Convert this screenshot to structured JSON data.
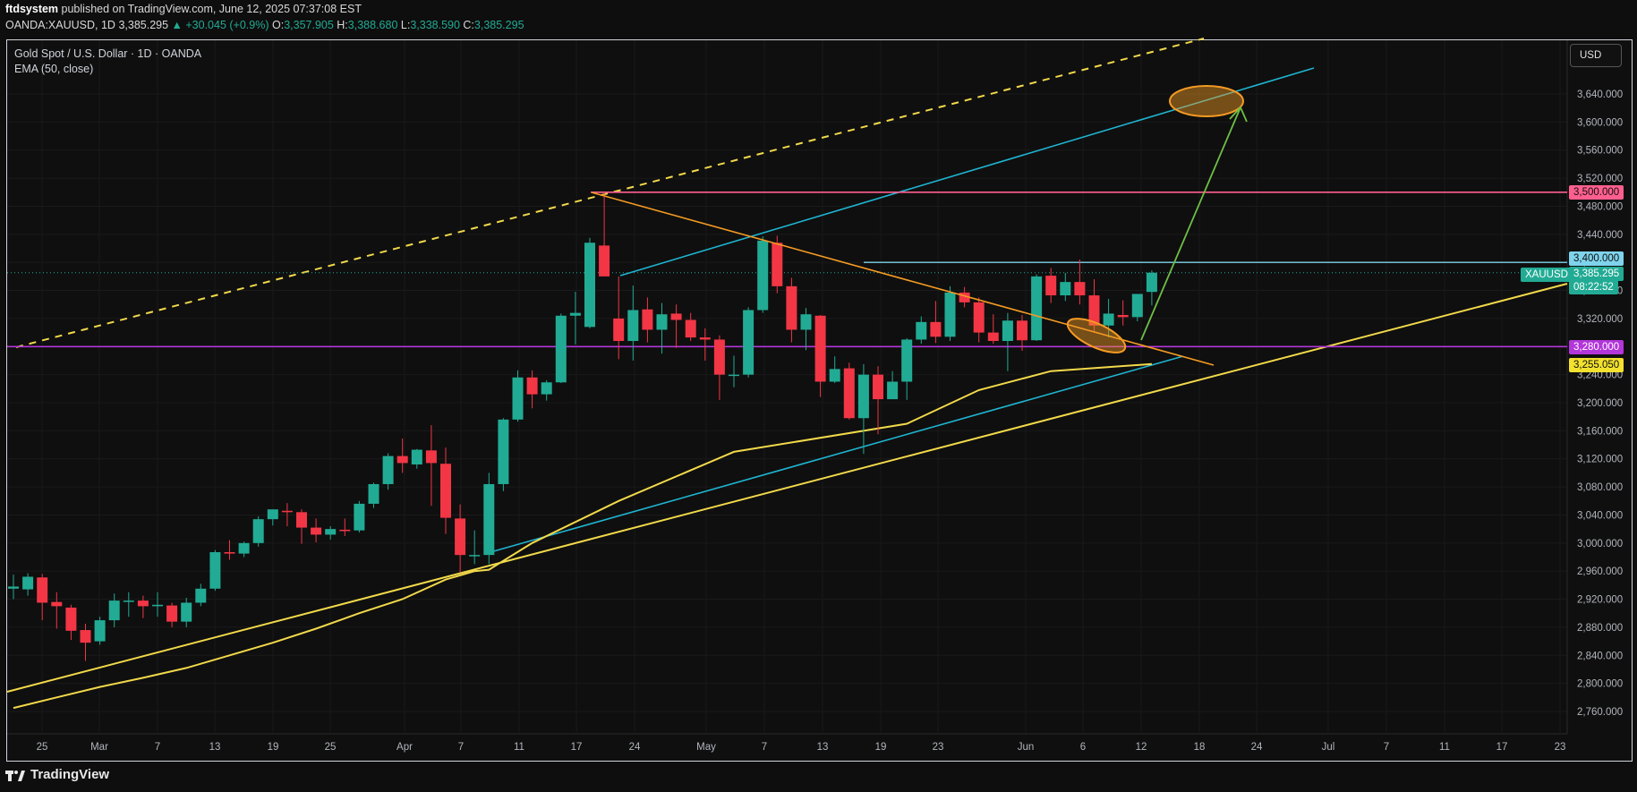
{
  "header": {
    "publisher": "ftdsystem",
    "published_text": "published on TradingView.com, June 12, 2025 07:37:08 EST",
    "symbol_line": "OANDA:XAUUSD, 1D",
    "last": "3,385.295",
    "change": "▲ +30.045 (+0.9%)",
    "open_label": "O:",
    "open": "3,357.905",
    "high_label": "H:",
    "high": "3,388.680",
    "low_label": "L:",
    "low": "3,338.590",
    "close_label": "C:",
    "close": "3,385.295"
  },
  "legend": {
    "title": "Gold Spot / U.S. Dollar · 1D · OANDA",
    "indicator": "EMA (50, close)"
  },
  "currency_button": "USD",
  "branding": "TradingView",
  "price_tags": {
    "r3500": "3,500.000",
    "r3400": "3,400.000",
    "symbol": "XAUUSD",
    "last": "3,385.295",
    "countdown": "08:22:52",
    "s3280": "3,280.000",
    "ema": "3,255.050"
  },
  "colors": {
    "up": "#22ab94",
    "down": "#f23645",
    "ema": "#f2d94a",
    "trend_yellow": "#f2d94a",
    "channel_cyan": "#1fb4d1",
    "triangle_orange": "#f59b23",
    "resistance_pink": "#ff5f8f",
    "support_purple": "#b236d9",
    "arrow_green": "#6fbf45"
  },
  "chart_data": {
    "type": "candlestick",
    "y_axis": {
      "min": 2740,
      "max": 3700,
      "ticks": [
        2760,
        2800,
        2840,
        2880,
        2920,
        2960,
        3000,
        3040,
        3080,
        3120,
        3160,
        3200,
        3240,
        3280,
        3320,
        3360,
        3400,
        3440,
        3480,
        3520,
        3560,
        3600,
        3640
      ],
      "tick_labels": [
        "2,760.000",
        "2,800.000",
        "2,840.000",
        "2,880.000",
        "2,920.000",
        "2,960.000",
        "3,000.000",
        "3,040.000",
        "3,080.000",
        "3,120.000",
        "3,160.000",
        "3,200.000",
        "3,240.000",
        "3,280.000",
        "3,320.000",
        "3,360.000",
        "3,400.000",
        "3,440.000",
        "3,480.000",
        "3,520.000",
        "3,560.000",
        "3,600.000",
        "3,640.000"
      ]
    },
    "x_axis": {
      "labels": [
        "25",
        "Mar",
        "7",
        "13",
        "19",
        "25",
        "Apr",
        "7",
        "11",
        "17",
        "24",
        "May",
        "7",
        "13",
        "19",
        "23",
        "Jun",
        "6",
        "12",
        "18",
        "24",
        "Jul",
        "7",
        "11",
        "17",
        "23"
      ]
    },
    "candles": [
      {
        "date": "2025-02-21",
        "o": 2935,
        "h": 2955,
        "l": 2920,
        "c": 2938
      },
      {
        "date": "2025-02-24",
        "o": 2934,
        "h": 2957,
        "l": 2925,
        "c": 2952
      },
      {
        "date": "2025-02-25",
        "o": 2951,
        "h": 2956,
        "l": 2890,
        "c": 2915
      },
      {
        "date": "2025-02-26",
        "o": 2916,
        "h": 2930,
        "l": 2878,
        "c": 2910
      },
      {
        "date": "2025-02-27",
        "o": 2908,
        "h": 2912,
        "l": 2862,
        "c": 2875
      },
      {
        "date": "2025-02-28",
        "o": 2876,
        "h": 2885,
        "l": 2832,
        "c": 2858
      },
      {
        "date": "2025-03-03",
        "o": 2860,
        "h": 2895,
        "l": 2855,
        "c": 2890
      },
      {
        "date": "2025-03-04",
        "o": 2890,
        "h": 2928,
        "l": 2880,
        "c": 2918
      },
      {
        "date": "2025-03-05",
        "o": 2918,
        "h": 2930,
        "l": 2895,
        "c": 2918
      },
      {
        "date": "2025-03-06",
        "o": 2918,
        "h": 2925,
        "l": 2893,
        "c": 2910
      },
      {
        "date": "2025-03-07",
        "o": 2910,
        "h": 2930,
        "l": 2895,
        "c": 2912
      },
      {
        "date": "2025-03-10",
        "o": 2911,
        "h": 2915,
        "l": 2880,
        "c": 2888
      },
      {
        "date": "2025-03-11",
        "o": 2888,
        "h": 2922,
        "l": 2880,
        "c": 2915
      },
      {
        "date": "2025-03-12",
        "o": 2915,
        "h": 2942,
        "l": 2910,
        "c": 2935
      },
      {
        "date": "2025-03-13",
        "o": 2935,
        "h": 2990,
        "l": 2932,
        "c": 2987
      },
      {
        "date": "2025-03-14",
        "o": 2987,
        "h": 3004,
        "l": 2976,
        "c": 2985
      },
      {
        "date": "2025-03-17",
        "o": 2985,
        "h": 3002,
        "l": 2980,
        "c": 3000
      },
      {
        "date": "2025-03-18",
        "o": 3000,
        "h": 3038,
        "l": 2995,
        "c": 3034
      },
      {
        "date": "2025-03-19",
        "o": 3034,
        "h": 3045,
        "l": 3025,
        "c": 3048
      },
      {
        "date": "2025-03-20",
        "o": 3046,
        "h": 3057,
        "l": 3024,
        "c": 3044
      },
      {
        "date": "2025-03-21",
        "o": 3044,
        "h": 3048,
        "l": 2999,
        "c": 3022
      },
      {
        "date": "2025-03-24",
        "o": 3022,
        "h": 3035,
        "l": 3001,
        "c": 3012
      },
      {
        "date": "2025-03-25",
        "o": 3012,
        "h": 3024,
        "l": 3005,
        "c": 3020
      },
      {
        "date": "2025-03-26",
        "o": 3019,
        "h": 3035,
        "l": 3010,
        "c": 3017
      },
      {
        "date": "2025-03-27",
        "o": 3018,
        "h": 3060,
        "l": 3015,
        "c": 3056
      },
      {
        "date": "2025-03-28",
        "o": 3056,
        "h": 3086,
        "l": 3050,
        "c": 3084
      },
      {
        "date": "2025-03-31",
        "o": 3084,
        "h": 3128,
        "l": 3076,
        "c": 3124
      },
      {
        "date": "2025-04-01",
        "o": 3124,
        "h": 3149,
        "l": 3100,
        "c": 3114
      },
      {
        "date": "2025-04-02",
        "o": 3112,
        "h": 3134,
        "l": 3106,
        "c": 3133
      },
      {
        "date": "2025-04-03",
        "o": 3132,
        "h": 3168,
        "l": 3053,
        "c": 3114
      },
      {
        "date": "2025-04-04",
        "o": 3113,
        "h": 3136,
        "l": 3013,
        "c": 3036
      },
      {
        "date": "2025-04-07",
        "o": 3035,
        "h": 3055,
        "l": 2958,
        "c": 2983
      },
      {
        "date": "2025-04-08",
        "o": 2983,
        "h": 3018,
        "l": 2970,
        "c": 2983
      },
      {
        "date": "2025-04-09",
        "o": 2983,
        "h": 3100,
        "l": 2970,
        "c": 3084
      },
      {
        "date": "2025-04-10",
        "o": 3084,
        "h": 3178,
        "l": 3074,
        "c": 3176
      },
      {
        "date": "2025-04-11",
        "o": 3176,
        "h": 3246,
        "l": 3173,
        "c": 3236
      },
      {
        "date": "2025-04-14",
        "o": 3236,
        "h": 3246,
        "l": 3192,
        "c": 3212
      },
      {
        "date": "2025-04-15",
        "o": 3212,
        "h": 3232,
        "l": 3203,
        "c": 3229
      },
      {
        "date": "2025-04-16",
        "o": 3229,
        "h": 3327,
        "l": 3228,
        "c": 3324
      },
      {
        "date": "2025-04-17",
        "o": 3324,
        "h": 3358,
        "l": 3283,
        "c": 3328
      },
      {
        "date": "2025-04-18",
        "o": 3308,
        "h": 3435,
        "l": 3306,
        "c": 3428
      },
      {
        "date": "2025-04-21",
        "o": 3424,
        "h": 3500,
        "l": 3380,
        "c": 3380
      },
      {
        "date": "2025-04-22",
        "o": 3320,
        "h": 3380,
        "l": 3262,
        "c": 3288
      },
      {
        "date": "2025-04-23",
        "o": 3288,
        "h": 3367,
        "l": 3260,
        "c": 3332
      },
      {
        "date": "2025-04-24",
        "o": 3333,
        "h": 3350,
        "l": 3286,
        "c": 3304
      },
      {
        "date": "2025-04-25",
        "o": 3304,
        "h": 3342,
        "l": 3270,
        "c": 3326
      },
      {
        "date": "2025-04-28",
        "o": 3327,
        "h": 3340,
        "l": 3278,
        "c": 3318
      },
      {
        "date": "2025-04-29",
        "o": 3318,
        "h": 3328,
        "l": 3288,
        "c": 3293
      },
      {
        "date": "2025-04-30",
        "o": 3293,
        "h": 3306,
        "l": 3260,
        "c": 3290
      },
      {
        "date": "2025-05-01",
        "o": 3290,
        "h": 3296,
        "l": 3204,
        "c": 3240
      },
      {
        "date": "2025-05-02",
        "o": 3240,
        "h": 3267,
        "l": 3222,
        "c": 3240
      },
      {
        "date": "2025-05-05",
        "o": 3240,
        "h": 3336,
        "l": 3236,
        "c": 3332
      },
      {
        "date": "2025-05-06",
        "o": 3332,
        "h": 3437,
        "l": 3328,
        "c": 3431
      },
      {
        "date": "2025-05-07",
        "o": 3428,
        "h": 3438,
        "l": 3356,
        "c": 3366
      },
      {
        "date": "2025-05-08",
        "o": 3366,
        "h": 3378,
        "l": 3286,
        "c": 3304
      },
      {
        "date": "2025-05-09",
        "o": 3304,
        "h": 3335,
        "l": 3275,
        "c": 3326
      },
      {
        "date": "2025-05-12",
        "o": 3324,
        "h": 3325,
        "l": 3208,
        "c": 3230
      },
      {
        "date": "2025-05-13",
        "o": 3230,
        "h": 3266,
        "l": 3228,
        "c": 3248
      },
      {
        "date": "2025-05-14",
        "o": 3249,
        "h": 3257,
        "l": 3176,
        "c": 3178
      },
      {
        "date": "2025-05-15",
        "o": 3178,
        "h": 3255,
        "l": 3127,
        "c": 3240
      },
      {
        "date": "2025-05-16",
        "o": 3240,
        "h": 3252,
        "l": 3155,
        "c": 3205
      },
      {
        "date": "2025-05-19",
        "o": 3205,
        "h": 3245,
        "l": 3205,
        "c": 3230
      },
      {
        "date": "2025-05-20",
        "o": 3230,
        "h": 3292,
        "l": 3204,
        "c": 3290
      },
      {
        "date": "2025-05-21",
        "o": 3290,
        "h": 3323,
        "l": 3284,
        "c": 3315
      },
      {
        "date": "2025-05-22",
        "o": 3315,
        "h": 3345,
        "l": 3285,
        "c": 3294
      },
      {
        "date": "2025-05-23",
        "o": 3294,
        "h": 3366,
        "l": 3288,
        "c": 3357
      },
      {
        "date": "2025-05-26",
        "o": 3357,
        "h": 3365,
        "l": 3336,
        "c": 3343
      },
      {
        "date": "2025-05-27",
        "o": 3343,
        "h": 3350,
        "l": 3286,
        "c": 3300
      },
      {
        "date": "2025-05-28",
        "o": 3300,
        "h": 3326,
        "l": 3284,
        "c": 3288
      },
      {
        "date": "2025-05-29",
        "o": 3288,
        "h": 3328,
        "l": 3245,
        "c": 3317
      },
      {
        "date": "2025-05-30",
        "o": 3317,
        "h": 3325,
        "l": 3274,
        "c": 3289
      },
      {
        "date": "2025-06-02",
        "o": 3289,
        "h": 3383,
        "l": 3288,
        "c": 3380
      },
      {
        "date": "2025-06-03",
        "o": 3381,
        "h": 3392,
        "l": 3342,
        "c": 3353
      },
      {
        "date": "2025-06-04",
        "o": 3353,
        "h": 3385,
        "l": 3345,
        "c": 3372
      },
      {
        "date": "2025-06-05",
        "o": 3372,
        "h": 3404,
        "l": 3340,
        "c": 3353
      },
      {
        "date": "2025-06-06",
        "o": 3353,
        "h": 3376,
        "l": 3302,
        "c": 3310
      },
      {
        "date": "2025-06-09",
        "o": 3310,
        "h": 3348,
        "l": 3293,
        "c": 3327
      },
      {
        "date": "2025-06-10",
        "o": 3325,
        "h": 3346,
        "l": 3310,
        "c": 3322
      },
      {
        "date": "2025-06-11",
        "o": 3322,
        "h": 3345,
        "l": 3316,
        "c": 3355
      },
      {
        "date": "2025-06-12",
        "o": 3357.905,
        "h": 3388.68,
        "l": 3338.59,
        "c": 3385.295
      }
    ],
    "ema50": [
      2780,
      2795,
      2810,
      2830,
      2860,
      2890,
      2920,
      2955,
      2990,
      3050,
      3110,
      3150,
      3175,
      3195,
      3215,
      3235,
      3245,
      3255.05
    ],
    "horizontal_levels": [
      3500,
      3400,
      3280
    ],
    "annotations": [
      "resistance 3,500",
      "resistance 3,400",
      "support 3,280",
      "EMA 3,255.050",
      "projected target near 3,640"
    ]
  }
}
